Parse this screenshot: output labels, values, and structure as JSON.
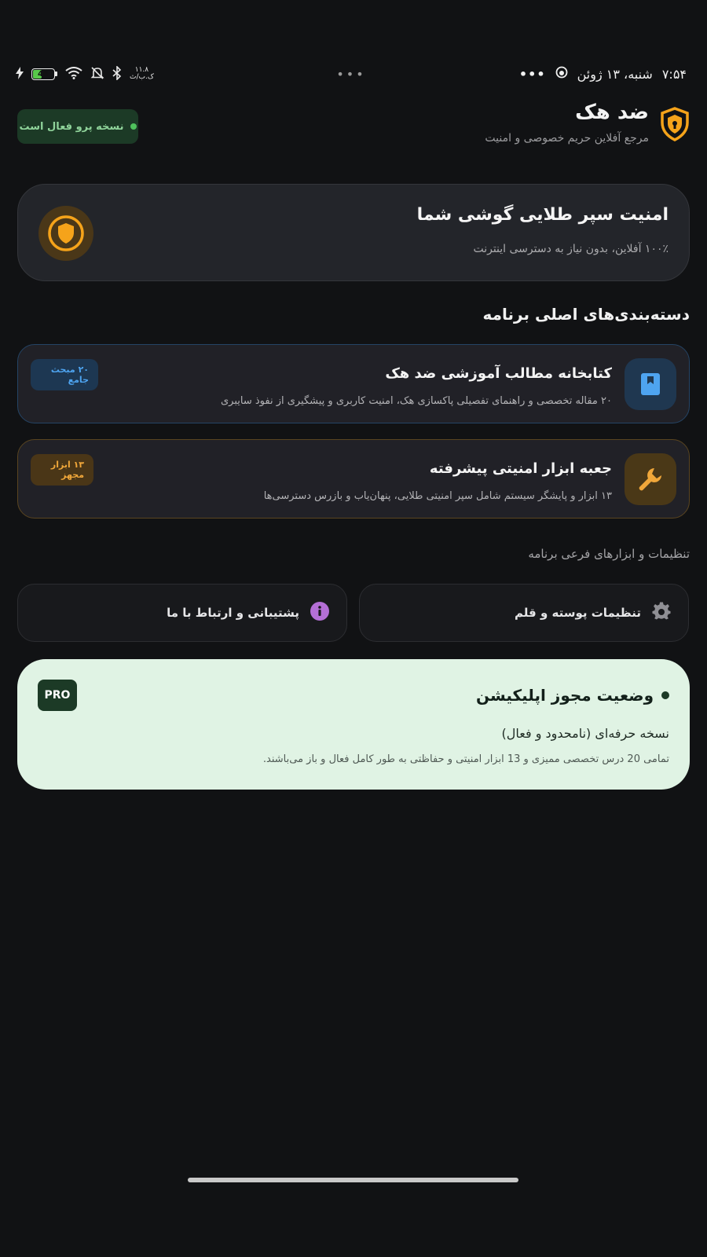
{
  "status_bar": {
    "time": "۷:۵۴",
    "date": "شنبه، ۱۳ ژوئن",
    "more": "•••",
    "center_dots": "•••",
    "battery_level": "46",
    "battery_fraction": 0.46,
    "net_speed_value": "۱۱.۸",
    "net_speed_unit": "ک.ب/ث",
    "colors": {
      "battery": "#58c94a"
    }
  },
  "header": {
    "title": "ضد هک",
    "subtitle": "مرجع آفلاین حریم خصوصی و امنیت",
    "logo_icon": "shield-icon",
    "pro_badge": "نسخه پرو فعال است"
  },
  "hero": {
    "title": "امنیت سپر طلایی گوشی شما",
    "subtitle": "۱۰۰٪ آفلاین، بدون نیاز به دسترسی اینترنت",
    "icon": "shield-icon"
  },
  "main_section_title": "دسته‌بندی‌های اصلی برنامه",
  "categories": [
    {
      "title": "کتابخانه مطالب آموزشی ضد هک",
      "description": "۲۰ مقاله تخصصی و راهنمای تفصیلی پاکسازی هک، امنیت کاربری و پیشگیری از نفوذ سایبری",
      "badge": "۲۰ مبحث جامع",
      "icon": "book-icon",
      "accent": "#4ea4f0"
    },
    {
      "title": "جعبه ابزار امنیتی پیشرفته",
      "description": "۱۳ ابزار و پایشگر سیستم شامل سپر امنیتی طلایی، پنهان‌یاب و بازرس دسترسی‌ها",
      "badge": "۱۳ ابزار مجهز",
      "icon": "wrench-icon",
      "accent": "#f0a73a"
    }
  ],
  "secondary_section_title": "تنظیمات و ابزارهای فرعی برنامه",
  "secondary": {
    "settings_label": "تنظیمات پوسته و قلم",
    "settings_icon": "gear-icon",
    "support_label": "پشتیبانی و ارتباط با ما",
    "support_icon": "info-icon"
  },
  "license": {
    "title": "وضعیت مجوز اپلیکیشن",
    "badge": "PRO",
    "status": "نسخه حرفه‌ای (نامحدود و فعال)",
    "description": "تمامی 20 درس تخصصی ممیزی و 13 ابزار امنیتی و حفاظتی به طور کامل فعال و باز می‌باشند."
  }
}
